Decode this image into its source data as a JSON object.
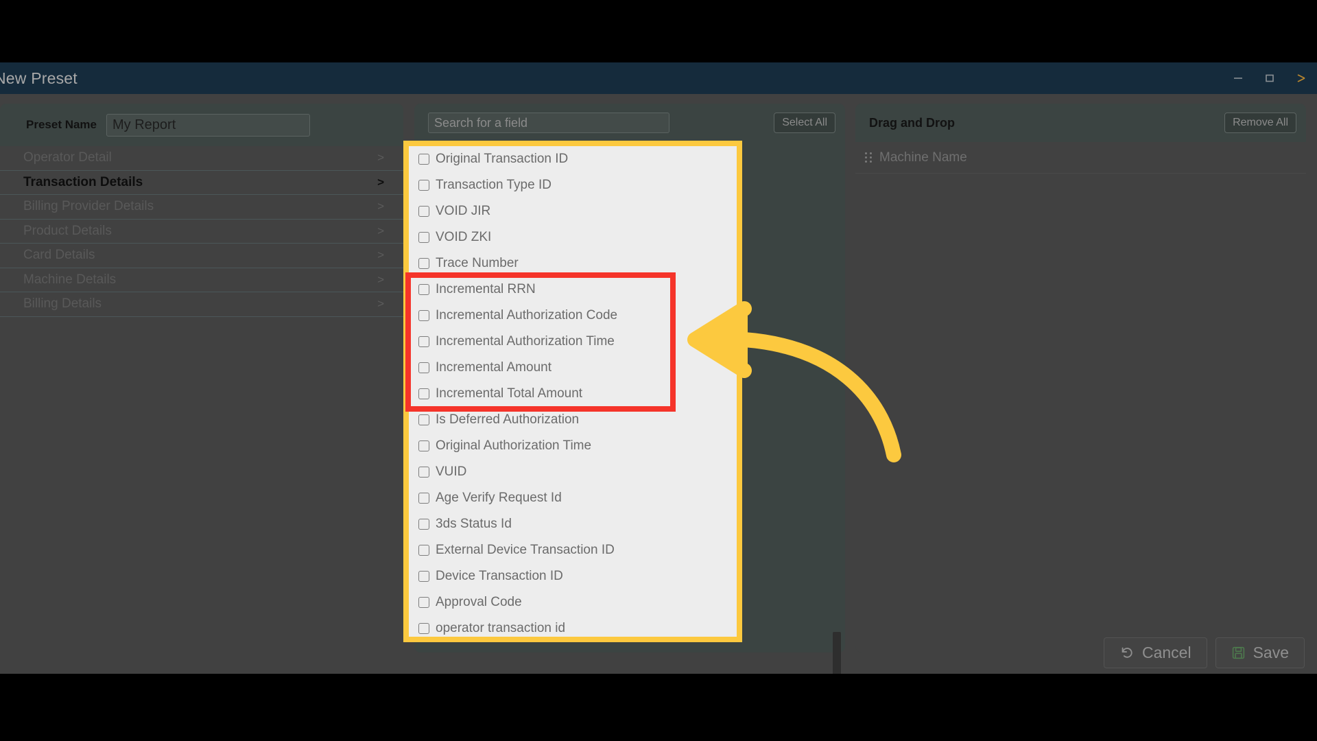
{
  "window": {
    "title": "New Preset",
    "controls": {
      "minimize": "minimize-icon",
      "maximize": "maximize-icon",
      "close": "close-icon"
    }
  },
  "left_panel": {
    "preset_name_label": "Preset Name",
    "preset_name_value": "My Report",
    "preset_name_placeholder": "Preset Name",
    "categories": [
      {
        "label": "Operator Detail",
        "chevron": ">",
        "active": false
      },
      {
        "label": "Transaction Details",
        "chevron": ">",
        "active": true
      },
      {
        "label": "Billing Provider Details",
        "chevron": ">",
        "active": false
      },
      {
        "label": "Product Details",
        "chevron": ">",
        "active": false
      },
      {
        "label": "Card Details",
        "chevron": ">",
        "active": false
      },
      {
        "label": "Machine Details",
        "chevron": ">",
        "active": false
      },
      {
        "label": "Billing Details",
        "chevron": ">",
        "active": false
      }
    ]
  },
  "middle_panel": {
    "search_placeholder": "Search for a field",
    "search_value": "",
    "select_all_label": "Select All",
    "fields": [
      {
        "label": "Original Transaction ID",
        "checked": false
      },
      {
        "label": "Transaction Type ID",
        "checked": false
      },
      {
        "label": "VOID JIR",
        "checked": false
      },
      {
        "label": "VOID ZKI",
        "checked": false
      },
      {
        "label": "Trace Number",
        "checked": false
      },
      {
        "label": "Incremental RRN",
        "checked": false
      },
      {
        "label": "Incremental Authorization Code",
        "checked": false
      },
      {
        "label": "Incremental Authorization Time",
        "checked": false
      },
      {
        "label": "Incremental Amount",
        "checked": false
      },
      {
        "label": "Incremental Total Amount",
        "checked": false
      },
      {
        "label": "Is Deferred Authorization",
        "checked": false
      },
      {
        "label": "Original Authorization Time",
        "checked": false
      },
      {
        "label": "VUID",
        "checked": false
      },
      {
        "label": "Age Verify Request Id",
        "checked": false
      },
      {
        "label": "3ds Status Id",
        "checked": false
      },
      {
        "label": "External Device Transaction ID",
        "checked": false
      },
      {
        "label": "Device Transaction ID",
        "checked": false
      },
      {
        "label": "Approval Code",
        "checked": false
      },
      {
        "label": "operator transaction id",
        "checked": false
      }
    ]
  },
  "right_panel": {
    "title": "Drag and Drop",
    "remove_all_label": "Remove All",
    "items": [
      {
        "label": "Machine Name",
        "handle": "drag-handle-icon"
      }
    ]
  },
  "footer": {
    "cancel_label": "Cancel",
    "cancel_icon": "undo-icon",
    "save_label": "Save",
    "save_icon": "floppy-disk-icon"
  },
  "annotations": {
    "highlight_box_color": "#FCC93F",
    "focus_box_color": "#F5342A",
    "arrow_color": "#FCC93F"
  },
  "colors": {
    "titlebar": "#152b3c",
    "window_bg": "#414141",
    "panel_bg": "#3b4442",
    "highlight_panel_bg": "#ededed"
  }
}
